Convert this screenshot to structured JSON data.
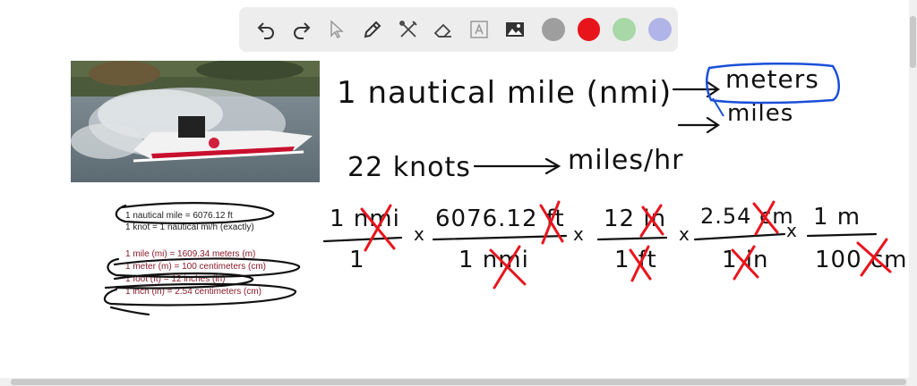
{
  "toolbar": {
    "tools": [
      {
        "name": "undo-icon"
      },
      {
        "name": "redo-icon"
      },
      {
        "name": "pointer-icon"
      },
      {
        "name": "pen-icon"
      },
      {
        "name": "tools-icon"
      },
      {
        "name": "eraser-icon"
      },
      {
        "name": "text-icon"
      },
      {
        "name": "image-icon"
      }
    ],
    "colors": [
      "#9e9e9e",
      "#e8141c",
      "#a8d8a8",
      "#b0b4e8"
    ]
  },
  "references": {
    "line1": "1 nautical mile = 6076.12 ft",
    "line2": "1 knot = 1 nautical mi/h (exactly)",
    "line3": "1 mile (mi) = 1609.34 meters (m)",
    "line4": "1 meter (m) = 100 centimeters (cm)",
    "line5": "1 foot (ft) = 12 inches (in)",
    "line6": "1 inch (in) = 2.54 centimeters (cm)"
  },
  "notes": {
    "nautical": "1 nautical mile (nmi)",
    "meters": "meters",
    "miles": "miles",
    "knots": "22 knots",
    "mph": "miles/hr",
    "f1_num": "1 nmi",
    "f1_den": "1",
    "f2_num": "6076.12 ft",
    "f2_den": "1 nmi",
    "f3_num": "12 in",
    "f3_den": "1 ft",
    "f4_num": "2.54 cm",
    "f4_den": "1 in",
    "f5_num": "1 m",
    "f5_den": "100 cm",
    "times": "x"
  }
}
